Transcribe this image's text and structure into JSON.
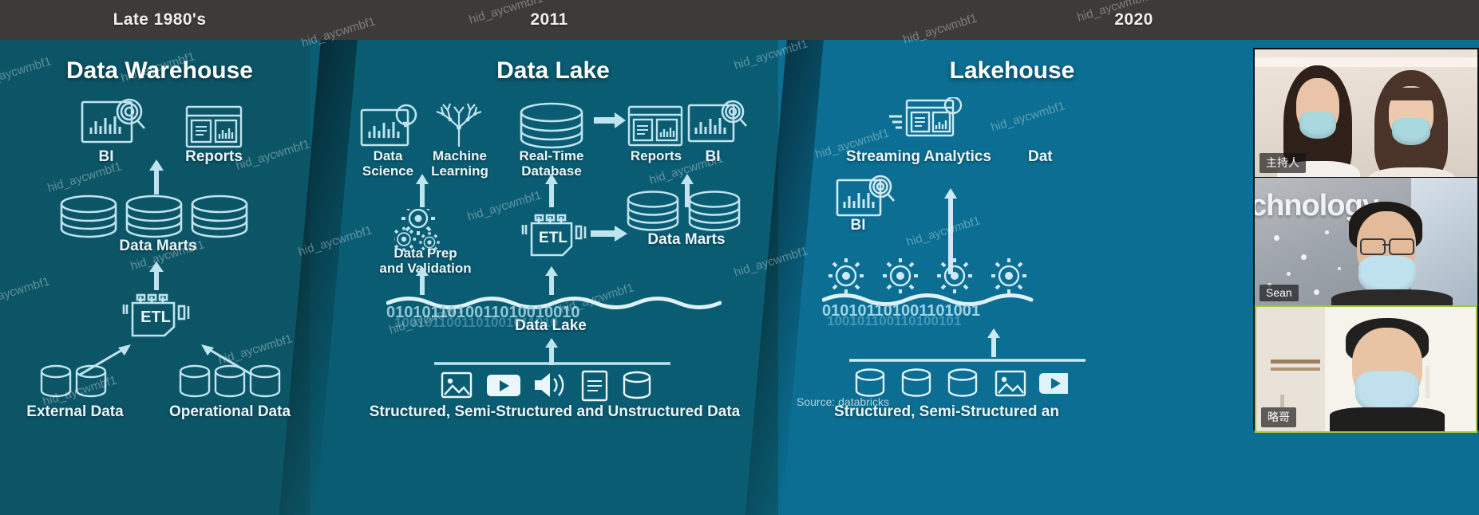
{
  "slide": {
    "source_credit": "Source: databricks",
    "panels": [
      {
        "era": "Late 1980's",
        "title": "Data Warehouse",
        "nodes": [
          {
            "label": "BI",
            "icon": "bi-chart-magnifier-icon"
          },
          {
            "label": "Reports",
            "icon": "reports-dashboard-icon"
          },
          {
            "label": "Data Marts",
            "icon": "database-cylinder-icon"
          },
          {
            "label": "ETL",
            "icon": "etl-icon"
          },
          {
            "label": "External Data",
            "icon": "small-cylinder-icon"
          },
          {
            "label": "Operational Data",
            "icon": "small-cylinder-icon"
          }
        ]
      },
      {
        "era": "2011",
        "title": "Data Lake",
        "nodes": [
          {
            "label": "Data\nScience",
            "icon": "bi-chart-bulb-icon"
          },
          {
            "label": "Machine\nLearning",
            "icon": "neural-tree-icon"
          },
          {
            "label": "Real-Time\nDatabase",
            "icon": "database-cylinder-icon"
          },
          {
            "label": "Reports",
            "icon": "reports-dashboard-icon"
          },
          {
            "label": "BI",
            "icon": "bi-chart-magnifier-icon"
          },
          {
            "label": "Data Prep\nand Validation",
            "icon": "gears-icon"
          },
          {
            "label": "ETL",
            "icon": "etl-icon"
          },
          {
            "label": "Data Marts",
            "icon": "database-cylinder-icon"
          },
          {
            "label": "Data Lake",
            "icon": "binary-wave-icon"
          },
          {
            "label": "Structured, Semi-Structured and Unstructured Data",
            "icon": "media-sources-icon"
          }
        ]
      },
      {
        "era": "2020",
        "title": "Lakehouse",
        "nodes": [
          {
            "label": "Streaming Analytics",
            "icon": "streaming-dashboard-icon"
          },
          {
            "label": "Dat",
            "icon": "truncated-node-icon"
          },
          {
            "label": "BI",
            "icon": "bi-chart-magnifier-icon"
          },
          {
            "label": "Structured, Semi-Structured an",
            "icon": "media-sources-icon"
          }
        ]
      }
    ]
  },
  "video_panel": {
    "participants": [
      {
        "name": "主持人",
        "active_speaker": false,
        "background_text": ""
      },
      {
        "name": "Sean",
        "active_speaker": false,
        "background_text": "chnology"
      },
      {
        "name": "略哥",
        "active_speaker": true,
        "background_text": ""
      }
    ]
  },
  "watermark": {
    "text": "hid_aycwmbf1"
  },
  "colors": {
    "panel1_bg": "#0c5566",
    "panel2_bg": "#0a5c72",
    "panel3_bg": "#0b6e92",
    "header_bg": "#3d3b39",
    "line": "#bfe3ef",
    "active_speaker": "#9fc83c"
  }
}
